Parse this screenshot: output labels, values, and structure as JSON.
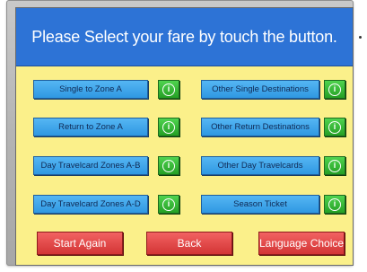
{
  "header": {
    "title": "Please Select your fare by touch the button."
  },
  "fares": [
    {
      "label": "Single to Zone A"
    },
    {
      "label": "Return to Zone A"
    },
    {
      "label": "Day Travelcard Zones A-B"
    },
    {
      "label": "Day Travelcard Zones A-D"
    },
    {
      "label": "Other Single Destinations"
    },
    {
      "label": "Other Return Destinations"
    },
    {
      "label": "Other Day Travelcards"
    },
    {
      "label": "Season Ticket"
    }
  ],
  "info_icon": "info-icon",
  "actions": {
    "start_again": "Start Again",
    "back": "Back",
    "language_choice": "Language Choice"
  },
  "colors": {
    "screen_background": "#fbf08a",
    "header_background": "#2d73d6",
    "fare_button": "#3aa3ea",
    "info_button": "#2fb32f",
    "action_button": "#e24545"
  }
}
